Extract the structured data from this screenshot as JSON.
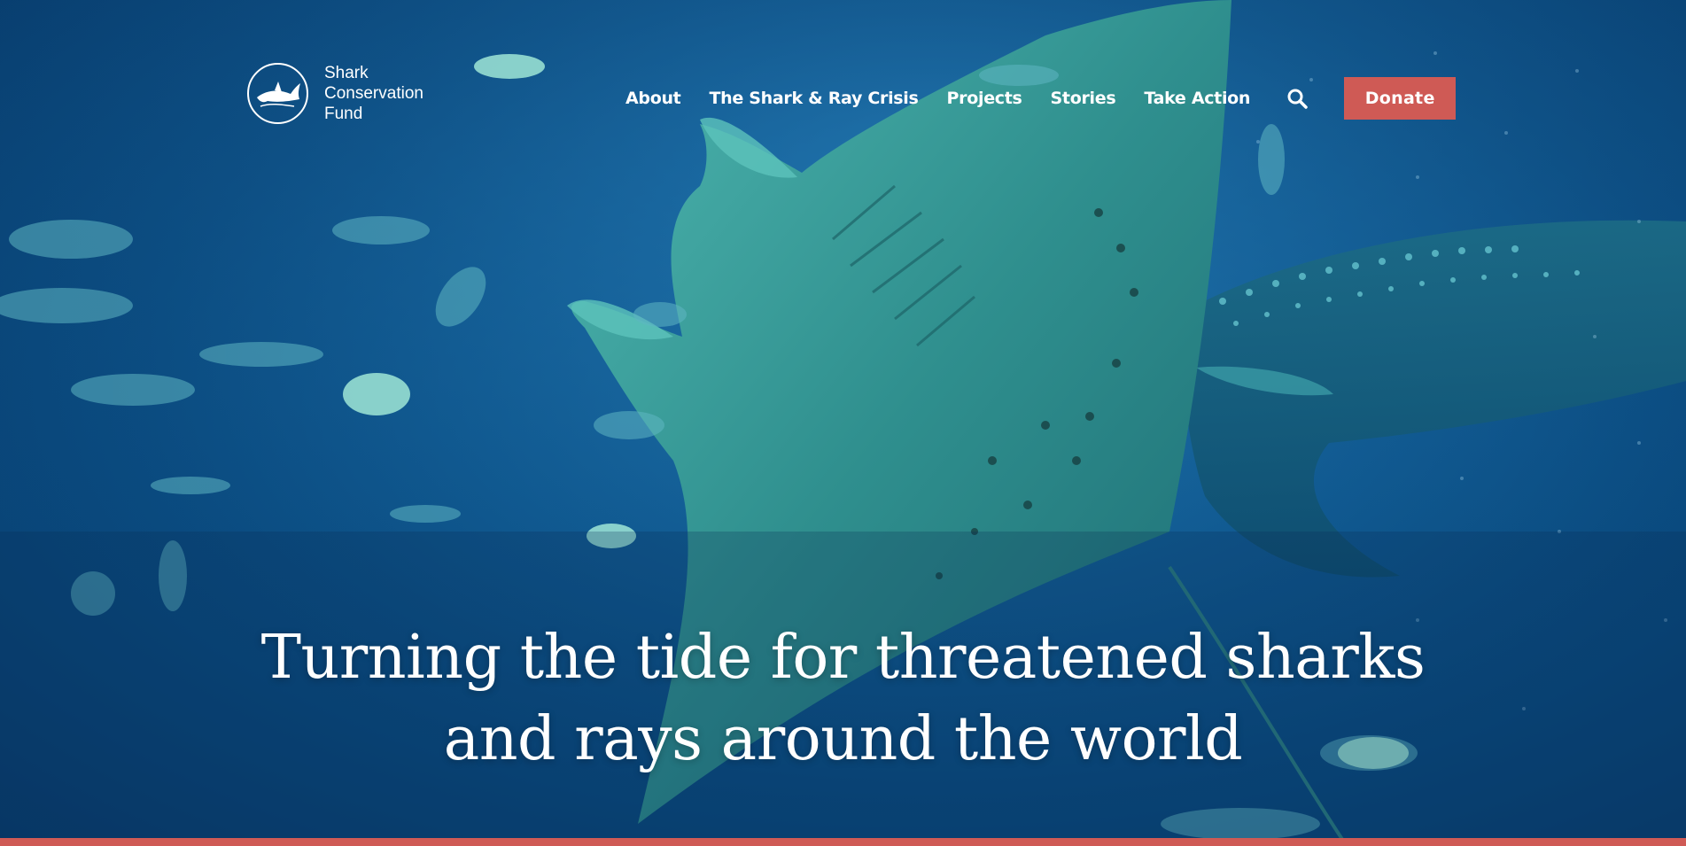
{
  "logo": {
    "line1": "Shark",
    "line2": "Conservation",
    "line3": "Fund"
  },
  "nav": {
    "items": [
      {
        "label": "About"
      },
      {
        "label": "The Shark & Ray Crisis"
      },
      {
        "label": "Projects"
      },
      {
        "label": "Stories"
      },
      {
        "label": "Take Action"
      }
    ],
    "search_icon": "search-icon",
    "donate_label": "Donate"
  },
  "hero": {
    "headline_line1": "Turning the tide for threatened sharks",
    "headline_line2": "and rays around the world"
  },
  "colors": {
    "accent": "#cf5a55",
    "ocean_deep": "#073a6a",
    "ocean_mid": "#1a6fa8",
    "manta": "#2a8a8a"
  }
}
